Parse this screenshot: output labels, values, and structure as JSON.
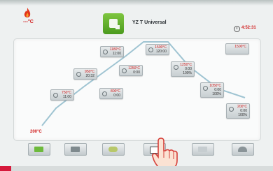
{
  "header": {
    "temperature": "---°C",
    "program_name": "YZ T Universal",
    "timer": "4:52:31"
  },
  "curve": {
    "start_temp": "200°C",
    "steps": [
      {
        "red": "750°C",
        "values": [
          "11:00"
        ]
      },
      {
        "red": "950°C",
        "values": [
          "20:32"
        ]
      },
      {
        "red": "1180°C",
        "values": [
          "11:00"
        ]
      },
      {
        "red": "1500°C",
        "values": [
          "120:00"
        ]
      },
      {
        "red": "800°C",
        "values": [
          "0:00"
        ]
      },
      {
        "red": "1250°C",
        "values": [
          "0:00"
        ]
      },
      {
        "red": "1250°C",
        "values": [
          "0:00",
          "100%"
        ]
      },
      {
        "red": "1050°C",
        "values": [
          "0:00",
          "100%"
        ]
      },
      {
        "red": "200°C",
        "values": [
          "0:00",
          "100%"
        ]
      },
      {
        "red": "1500°C",
        "values": []
      }
    ]
  },
  "toolbar": {
    "buttons": [
      "program-list",
      "edit",
      "night-mode",
      "print",
      "info",
      "back"
    ]
  },
  "colors": {
    "accent_green": "#5aad26",
    "temp_red": "#d01818",
    "bottom_marker": "#d61a3c"
  }
}
